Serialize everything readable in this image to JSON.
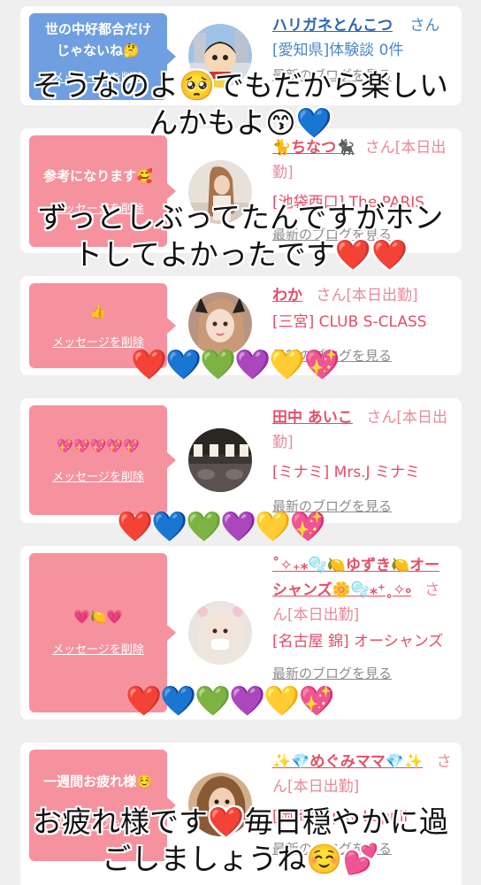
{
  "cards": [
    {
      "message": "世の中好都合だけ\nじゃないね🤔",
      "delete_label": "メッセージを削除",
      "name": "ハリガネとんこつ",
      "suffix": "さん",
      "shop": "[愛知県]体験談 0件",
      "blog": "最新のブログを見る",
      "bubble_color": "#6f9fe0",
      "name_color": "#2867b2"
    },
    {
      "message": "参考になります🥰",
      "delete_label": "メッセージを削除",
      "name": "🐈ちなつ🐈‍⬛",
      "suffix": "さん[本日出勤]",
      "shop": "[池袋西口] The PARIS",
      "blog": "最新のブログを見る",
      "bubble_color": "#f5929e"
    },
    {
      "message": "👍",
      "delete_label": "メッセージを削除",
      "name": "わか",
      "suffix": "さん[本日出勤]",
      "shop": "[三宮] CLUB S-CLASS",
      "blog": "最新のブログを見る",
      "bubble_color": "#f5929e"
    },
    {
      "message": "💖💖💖💖💖",
      "delete_label": "メッセージを削除",
      "name": "田中 あいこ",
      "suffix": "さん[本日出勤]",
      "shop": "[ミナミ] Mrs.J ミナミ",
      "blog": "最新のブログを見る",
      "bubble_color": "#f5929e"
    },
    {
      "message": "💗🍋💗",
      "delete_label": "メッセージを削除",
      "name": "˚✧₊⁎🫧🍋ゆずき🍋オーシャンズ🌼🫧⁎⁺˳✧༚",
      "suffix": "さん[本日出勤]",
      "shop": "[名古屋 錦] オーシャンズ",
      "blog": "最新のブログを見る",
      "bubble_color": "#f5929e"
    },
    {
      "message": "一週間お疲れ様☺️",
      "delete_label": "メッセージを削除",
      "name": "✨💎めぐみママ💎✨",
      "suffix": "さん[本日出勤]",
      "shop": "[岡崎] Tipsy Lapuli",
      "blog": "最新のブログを見る",
      "bubble_color": "#f5929e"
    }
  ],
  "overlays": {
    "top": "そうなのよ🥺でもだから楽しい\nんかもよ😙💙",
    "second": "ずっとしぶってたんですがホン\nトしてよかったです❤️❤️",
    "hearts_a": "❤️💙💚💜💛💖",
    "hearts_b": "❤️💙💚💜💛💖",
    "hearts_c": "❤️💙💚💜💛💖",
    "bottom": "お疲れ様です❤️毎日穏やかに過\nごしましょうね☺️💕"
  },
  "colors": {
    "page_bg": "#efefef",
    "accent_pink": "#e44e68",
    "bubble_pink": "#f5929e",
    "bubble_blue": "#6f9fe0",
    "link_blue": "#2867b2"
  }
}
